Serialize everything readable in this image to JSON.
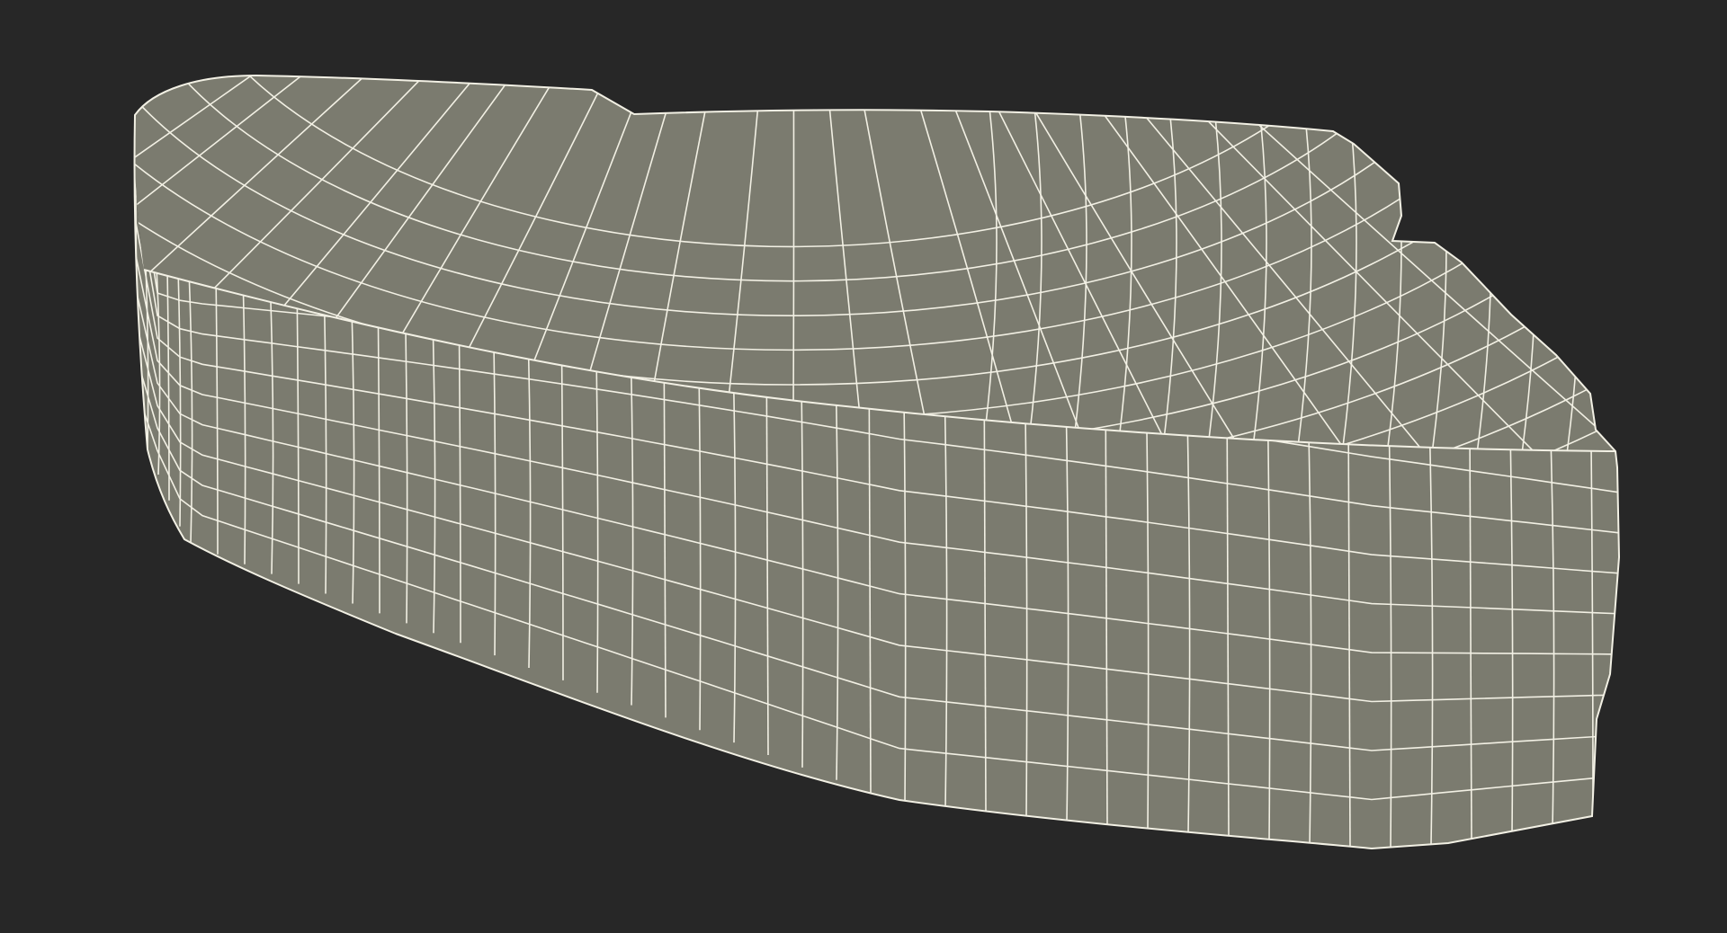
{
  "scene": {
    "background_color": "#272727",
    "surface_color": "#7b7b6f",
    "wire_color": "#f2f0e4",
    "subject": "wireframe-mesh-render"
  }
}
